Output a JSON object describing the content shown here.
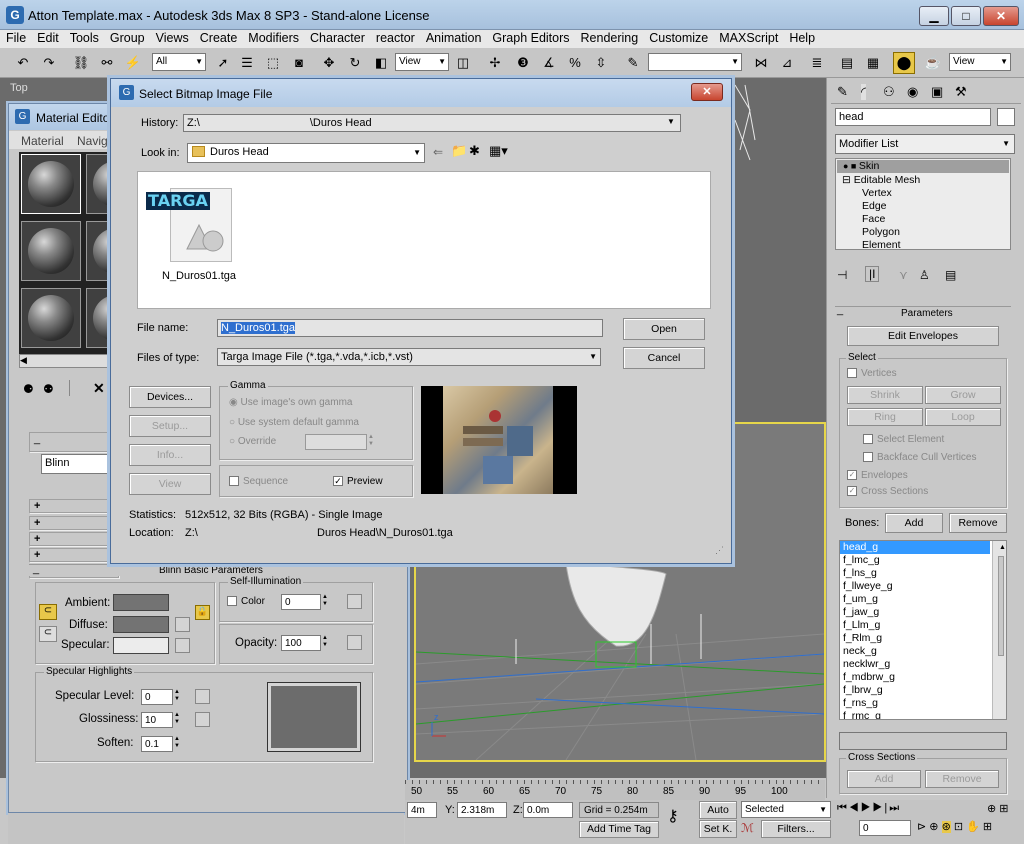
{
  "window": {
    "title": "Atton Template.max - Autodesk 3ds Max 8 SP3  - Stand-alone License",
    "min": "▁",
    "max": "□",
    "close": "✕"
  },
  "menu": [
    "File",
    "Edit",
    "Tools",
    "Group",
    "Views",
    "Create",
    "Modifiers",
    "Character",
    "reactor",
    "Animation",
    "Graph Editors",
    "Rendering",
    "Customize",
    "MAXScript",
    "Help"
  ],
  "toolbar": {
    "selection_filter": "All",
    "ref_coord": "View",
    "named_sel": "",
    "view_right": "View"
  },
  "viewport_top": {
    "label": "Top"
  },
  "material_editor": {
    "title": "Material Edito",
    "menu": [
      "Material",
      "Navig"
    ],
    "shader": "Blinn",
    "basic_params_title": "Blinn Basic Parameters",
    "ambient": "Ambient:",
    "diffuse": "Diffuse:",
    "specular": "Specular:",
    "self_illum": "Self-Illumination",
    "color_label": "Color",
    "color_value": "0",
    "opacity_label": "Opacity:",
    "opacity_value": "100",
    "spec_highlights": "Specular Highlights",
    "spec_level_label": "Specular Level:",
    "spec_level": "0",
    "gloss_label": "Glossiness:",
    "gloss": "10",
    "soften_label": "Soften:",
    "soften": "0.1"
  },
  "dialog": {
    "title": "Select Bitmap Image File",
    "close": "✕",
    "history_label": "History:",
    "history_value": "Z:\\                                    \\Duros Head",
    "lookin_label": "Look in:",
    "lookin_value": "Duros Head",
    "file_badge": "TARGA",
    "file_name_item": "N_Duros01.tga",
    "filename_label": "File name:",
    "filename_value": "N_Duros01.tga",
    "open": "Open",
    "filetype_label": "Files of type:",
    "filetype_value": "Targa Image File (*.tga,*.vda,*.icb,*.vst)",
    "cancel": "Cancel",
    "devices": "Devices...",
    "setup": "Setup...",
    "info": "Info...",
    "view": "View",
    "gamma": "Gamma",
    "gamma_own": "Use image's own gamma",
    "gamma_system": "Use system default gamma",
    "gamma_override": "Override",
    "sequence": "Sequence",
    "preview": "Preview",
    "stats_label": "Statistics:",
    "stats_value": "512x512, 32 Bits (RGBA) - Single Image",
    "location_label": "Location:",
    "location_drive": "Z:\\",
    "location_value": "Duros Head\\N_Duros01.tga"
  },
  "command_panel": {
    "object_name": "head",
    "modifier_list": "Modifier List",
    "stack": [
      "Skin",
      "Editable Mesh",
      "Vertex",
      "Edge",
      "Face",
      "Polygon",
      "Element"
    ],
    "parameters": "Parameters",
    "edit_envelopes": "Edit Envelopes",
    "select": "Select",
    "vertices": "Vertices",
    "shrink": "Shrink",
    "grow": "Grow",
    "ring": "Ring",
    "loop": "Loop",
    "select_element": "Select Element",
    "backface": "Backface Cull Vertices",
    "envelopes": "Envelopes",
    "cross_sections": "Cross Sections",
    "bones_label": "Bones:",
    "add": "Add",
    "remove": "Remove",
    "bones": [
      "head_g",
      "f_lmc_g",
      "f_lns_g",
      "f_llweye_g",
      "f_um_g",
      "f_jaw_g",
      "f_Llm_g",
      "f_Rlm_g",
      "neck_g",
      "necklwr_g",
      "f_mdbrw_g",
      "f_lbrw_g",
      "f_rns_g",
      "f_rmc_g"
    ],
    "cross_sections_title": "Cross Sections",
    "cs_add": "Add",
    "cs_remove": "Remove"
  },
  "timeline": {
    "ticks": [
      "50",
      "55",
      "60",
      "65",
      "70",
      "75",
      "80",
      "85",
      "90",
      "95",
      "100"
    ]
  },
  "status": {
    "x_value": "4m",
    "y_label": "Y:",
    "y_value": "2.318m",
    "z_label": "Z:",
    "z_value": "0.0m",
    "grid": "Grid = 0.254m",
    "add_time_tag": "Add Time Tag",
    "auto": "Auto",
    "setk": "Set K.",
    "selected": "Selected",
    "filters": "Filters...",
    "frame": "0"
  }
}
